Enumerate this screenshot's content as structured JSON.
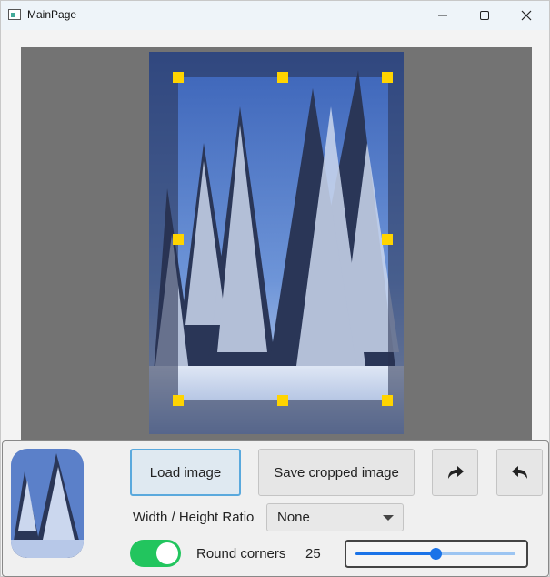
{
  "window": {
    "title": "MainPage"
  },
  "toolbar": {
    "load_label": "Load image",
    "save_label": "Save cropped image"
  },
  "ratio": {
    "label": "Width / Height Ratio",
    "selected": "None"
  },
  "corners": {
    "label": "Round corners",
    "value": "25",
    "enabled": true,
    "slider_fraction": 0.5
  },
  "colors": {
    "accent": "#1a73e8",
    "toggle_on": "#22c55e",
    "handle": "#ffd400"
  }
}
